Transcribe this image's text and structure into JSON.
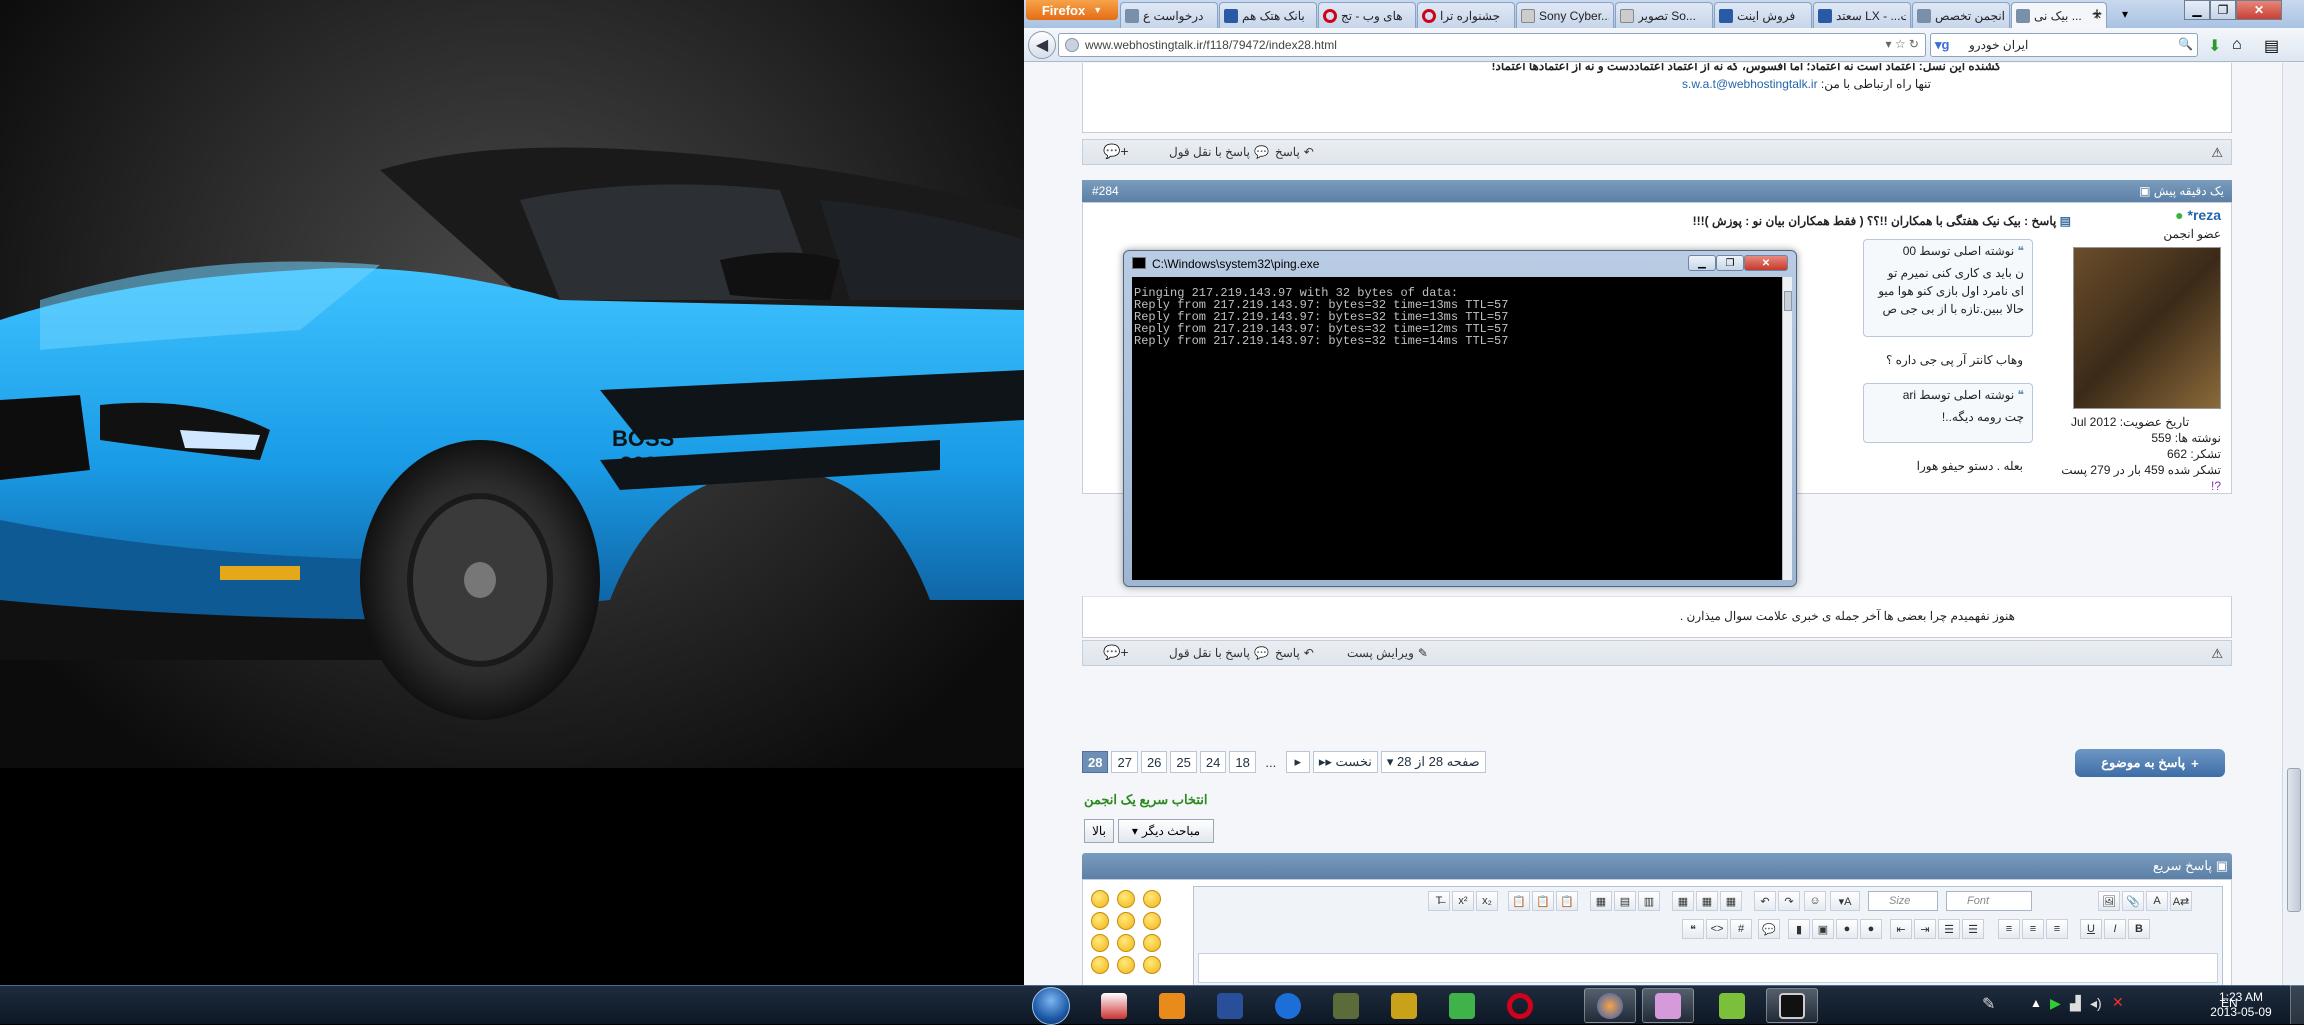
{
  "browser": {
    "menu_button": "Firefox",
    "tabs": [
      {
        "label": "درخواست ع",
        "icon": "page-icon"
      },
      {
        "label": "بانک هتک هم",
        "icon": "page-icon"
      },
      {
        "label": "های وب - تج",
        "icon": "opera-icon"
      },
      {
        "label": "جشنواره ترا",
        "icon": "opera-icon"
      },
      {
        "label": "Sony Cyber...",
        "icon": "blank-page-icon"
      },
      {
        "label": "تصویر So...",
        "icon": "blank-page-icon"
      },
      {
        "label": "فروش اینت",
        "icon": "page-icon"
      },
      {
        "label": "سعتد LX - ...ت",
        "icon": "page-icon"
      },
      {
        "label": "انجمن تخصص",
        "icon": "page-icon"
      },
      {
        "label": "بیک نی ...",
        "icon": "page-icon",
        "active": true
      }
    ],
    "url": "www.webhostingtalk.ir/f118/79472/index28.html",
    "search_value": "ایران خودرو",
    "search_engine": "g"
  },
  "posts": {
    "prev_footer": {
      "signature_line1": "کشنده این نسل: اعتماد است نه اعتماد؛ اما افسوس، که نه از اعتماد اعتماد‌دست و نه از اعتماد‌ها اعتماد!",
      "contact_prefix": "تنها راه ارتباطی با من:",
      "contact_email": "s.w.a.t@webhostingtalk.ir",
      "reply": "پاسخ",
      "reply_quote": "پاسخ با نقل قول"
    },
    "post284": {
      "number": "#284",
      "time": "یک دقیقه پیش",
      "title": "پاسخ : بیک نیک هفتگی با همکاران !!؟؟ ( فقط همکاران بیان نو : پوزش )!!!",
      "username": "reza*",
      "user_title": "عضو انجمن",
      "join_label": "تاریخ عضویت:",
      "join_value": "Jul 2012",
      "posts_label": "نوشته ها:",
      "posts_value": "559",
      "thanks_label": "تشکر:",
      "thanks_value": "662",
      "thanked": "تشکر شده 459 بار در 279 پست",
      "quote1_author": "نوشته اصلی توسط 00",
      "quote1_lines": [
        "ن باید ی کاری کنی نمیرم تو",
        "ای نامرد اول بازی کنو هوا میو",
        "حالا ببین.تازه با از بی جی ص"
      ],
      "text1": "وهاب کانتر آر پی جی داره ؟",
      "quote2_author": "نوشته اصلی توسط ari",
      "quote2_line": "چت رومه دیگه..!",
      "text2": "بعله . دستو حیفو هورا",
      "text3": "هنوز نفهمیدم چرا بعضی ها آخر جمله ی خبری علامت سوال میذارن .",
      "reply": "پاسخ",
      "reply_quote": "پاسخ با نقل قول",
      "edit": "ویرایش پست"
    }
  },
  "console": {
    "title": "C:\\Windows\\system32\\ping.exe",
    "lines": [
      "Pinging 217.219.143.97 with 32 bytes of data:",
      "Reply from 217.219.143.97: bytes=32 time=13ms TTL=57",
      "Reply from 217.219.143.97: bytes=32 time=13ms TTL=57",
      "Reply from 217.219.143.97: bytes=32 time=12ms TTL=57",
      "Reply from 217.219.143.97: bytes=32 time=14ms TTL=57"
    ]
  },
  "pagination": {
    "current": "28",
    "pages": [
      "27",
      "26",
      "25",
      "24",
      "18"
    ],
    "ellipsis": "...",
    "next": "▸",
    "first": "نخست",
    "page_of": "صفحه 28 از 28"
  },
  "reply_topic": "پاسخ به موضوع",
  "quick_mod_title": "انتخاب سریع یک انجمن",
  "btn_top": "بالا",
  "btn_other": "مباحث دیگر",
  "quick_reply": {
    "title": "پاسخ سریع",
    "size_placeholder": "Size",
    "font_placeholder": "Font"
  },
  "taskbar": {
    "lang": "EN",
    "time": "1:23 AM",
    "date": "2013-05-09"
  }
}
